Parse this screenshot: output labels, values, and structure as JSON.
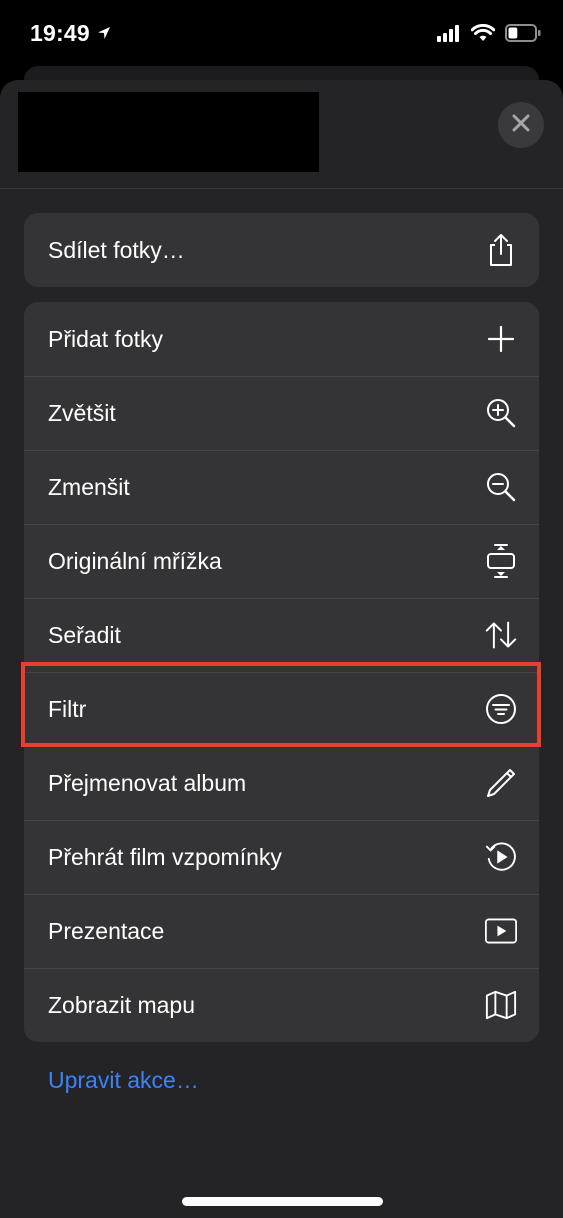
{
  "status_bar": {
    "time": "19:49",
    "location_icon": "location-arrow-icon",
    "signal_icon": "cellular-signal-icon",
    "wifi_icon": "wifi-icon",
    "battery_icon": "battery-icon",
    "battery_level": 0.35
  },
  "sheet": {
    "close_icon": "close-icon"
  },
  "share_group": {
    "items": [
      {
        "label": "Sdílet fotky…",
        "icon": "share-icon"
      }
    ]
  },
  "actions_group": {
    "items": [
      {
        "label": "Přidat fotky",
        "icon": "plus-icon"
      },
      {
        "label": "Zvětšit",
        "icon": "zoom-in-icon"
      },
      {
        "label": "Zmenšit",
        "icon": "zoom-out-icon"
      },
      {
        "label": "Originální mřížka",
        "icon": "aspect-ratio-icon"
      },
      {
        "label": "Seřadit",
        "icon": "sort-arrows-icon"
      },
      {
        "label": "Filtr",
        "icon": "filter-icon"
      },
      {
        "label": "Přejmenovat album",
        "icon": "pencil-icon"
      },
      {
        "label": "Přehrát film vzpomínky",
        "icon": "memory-replay-icon"
      },
      {
        "label": "Prezentace",
        "icon": "slideshow-play-icon"
      },
      {
        "label": "Zobrazit mapu",
        "icon": "map-icon"
      }
    ]
  },
  "footer": {
    "edit_actions_label": "Upravit akce…"
  },
  "colors": {
    "sheet_background": "#242426",
    "row_background": "#343436",
    "highlight_border": "#e8402f",
    "link": "#3d82f6"
  }
}
